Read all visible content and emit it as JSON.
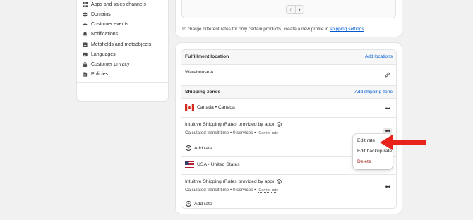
{
  "sidebar": {
    "items": [
      {
        "label": "Apps and sales channels",
        "icon": "apps-icon"
      },
      {
        "label": "Domains",
        "icon": "globe-icon"
      },
      {
        "label": "Customer events",
        "icon": "customer-events-icon"
      },
      {
        "label": "Notifications",
        "icon": "bell-icon"
      },
      {
        "label": "Metafields and metaobjects",
        "icon": "metafields-icon"
      },
      {
        "label": "Languages",
        "icon": "languages-icon"
      },
      {
        "label": "Customer privacy",
        "icon": "lock-icon"
      },
      {
        "label": "Policies",
        "icon": "document-icon"
      }
    ]
  },
  "top_card": {
    "pager_prev": "‹",
    "pager_next": "›",
    "info_text": "To charge different rates for only certain products, create a new profile in",
    "info_link": "shipping settings"
  },
  "fulfillment": {
    "header": "Fulfillment location",
    "add_locations": "Add locations",
    "location": "Warehouse A"
  },
  "zones": {
    "header": "Shipping zones",
    "add_zone": "Add shipping zone",
    "list": [
      {
        "name": "Canada • Canada",
        "flag": "canada",
        "rate_title": "Intuitive Shipping (Rates provided by app)",
        "rate_detail": "Calculated transit time • 0 services •",
        "carrier_badge": "Carrier rate",
        "add_rate": "Add rate"
      },
      {
        "name": "USA • United States",
        "flag": "usa",
        "rate_title": "Intuitive Shipping (Rates provided by app)",
        "rate_detail": "Calculated transit time • 0 services •",
        "carrier_badge": "Carrier rate",
        "add_rate": "Add rate"
      }
    ]
  },
  "menu": {
    "items": [
      "Edit rate",
      "Edit backup rate",
      "Delete"
    ]
  },
  "colors": {
    "link": "#005bd3",
    "danger": "#8e1f0b",
    "annotation_arrow": "#e8231b"
  }
}
